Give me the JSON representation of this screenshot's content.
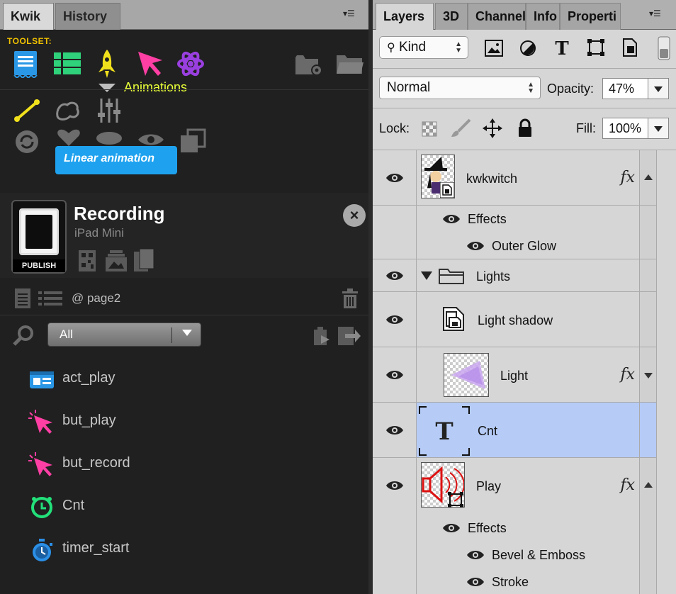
{
  "kwik": {
    "tabs": [
      "Kwik",
      "History"
    ],
    "toolset_label": "TOOLSET:",
    "animations_label": "Animations",
    "tooltip": "Linear animation",
    "project": {
      "title": "Recording",
      "device": "iPad Mini",
      "publish_label": "PUBLISH"
    },
    "page_label": "@ page2",
    "filter": {
      "value": "All"
    },
    "items": [
      {
        "label": "act_play",
        "icon": "action-icon"
      },
      {
        "label": "but_play",
        "icon": "button-cursor-icon"
      },
      {
        "label": "but_record",
        "icon": "button-cursor-icon"
      },
      {
        "label": "Cnt",
        "icon": "alarm-clock-icon"
      },
      {
        "label": "timer_start",
        "icon": "stopwatch-icon"
      }
    ]
  },
  "layers_panel": {
    "tabs": [
      "Layers",
      "3D",
      "Channel",
      "Info",
      "Properti"
    ],
    "filter_kind": "Kind",
    "blend_mode": "Normal",
    "opacity_label": "Opacity:",
    "opacity": "47%",
    "lock_label": "Lock:",
    "fill_label": "Fill:",
    "fill": "100%",
    "layers": [
      {
        "name": "kwkwitch",
        "effects_label": "Effects",
        "effects": [
          "Outer Glow"
        ]
      },
      {
        "name": "Lights"
      },
      {
        "name": "Light shadow"
      },
      {
        "name": "Light"
      },
      {
        "name": "Cnt"
      },
      {
        "name": "Play",
        "effects_label": "Effects",
        "effects": [
          "Bevel & Emboss",
          "Stroke"
        ]
      }
    ],
    "fx_symbol": "fx"
  },
  "colors": {
    "toolset": "#f0c000",
    "animations": "#e9ff39",
    "tooltip_bg": "#1ea2ef",
    "selected_layer": "#b6ccf7",
    "cursor_pink": "#ff3fa4",
    "timer_green": "#22e07a",
    "timer_blue": "#2b8fe6"
  }
}
